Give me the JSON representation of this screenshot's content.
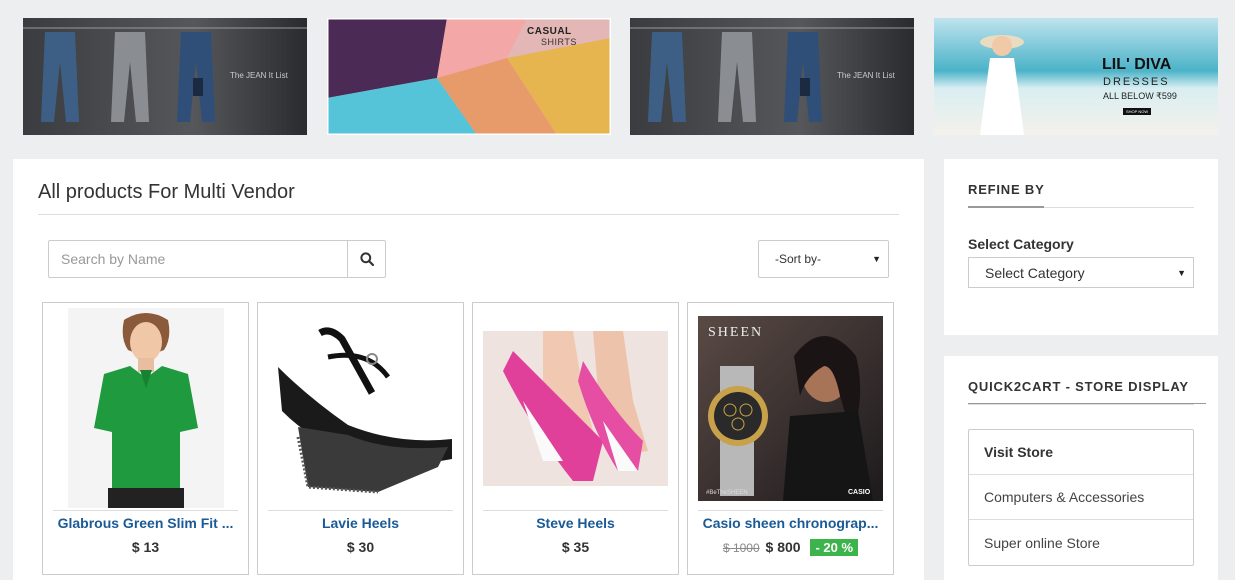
{
  "banners": [
    {
      "caption": "The JEAN It List"
    },
    {
      "caption": "CASUAL",
      "caption2": "SHIRTS"
    },
    {
      "caption": "The JEAN It List"
    },
    {
      "caption": "LIL' DIVA",
      "caption2": "DRESSES",
      "caption3": "ALL BELOW ₹599",
      "cta": "SHOP NOW"
    }
  ],
  "main": {
    "title": "All products For Multi Vendor",
    "search": {
      "placeholder": "Search by Name"
    },
    "sort": {
      "selected": "-Sort by-"
    }
  },
  "products": [
    {
      "name": "Glabrous Green Slim Fit ...",
      "price": "$ 13"
    },
    {
      "name": "Lavie Heels",
      "price": "$ 30"
    },
    {
      "name": "Steve Heels",
      "price": "$ 35"
    },
    {
      "name": "Casio sheen chronograp...",
      "old_price": "$ 1000",
      "price": "$ 800",
      "discount": "- 20 %"
    }
  ],
  "refine": {
    "heading": "REFINE BY",
    "category_label": "Select Category",
    "category_selected": "Select Category"
  },
  "store_display": {
    "heading": "QUICK2CART - STORE DISPLAY",
    "items": [
      "Visit Store",
      "Computers & Accessories",
      "Super online Store"
    ]
  },
  "colors": {
    "link_blue": "#1a5a96",
    "discount_green": "#3cb44b",
    "background": "#eceef0"
  }
}
